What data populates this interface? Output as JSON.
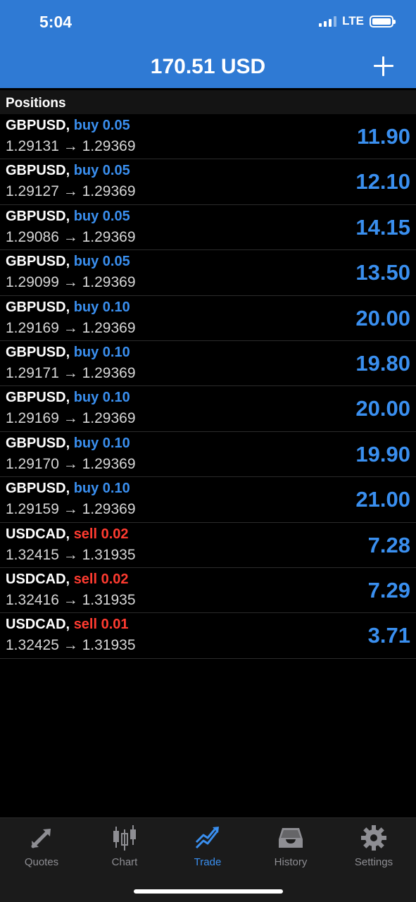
{
  "status": {
    "time": "5:04",
    "network": "LTE"
  },
  "header": {
    "balance": "170.51 USD"
  },
  "section": {
    "title": "Positions"
  },
  "positions": [
    {
      "symbol": "GBPUSD,",
      "side": "buy",
      "side_text": "buy 0.05",
      "open": "1.29131",
      "arrow": "→",
      "current": "1.29369",
      "profit": "11.90"
    },
    {
      "symbol": "GBPUSD,",
      "side": "buy",
      "side_text": "buy 0.05",
      "open": "1.29127",
      "arrow": "→",
      "current": "1.29369",
      "profit": "12.10"
    },
    {
      "symbol": "GBPUSD,",
      "side": "buy",
      "side_text": "buy 0.05",
      "open": "1.29086",
      "arrow": "→",
      "current": "1.29369",
      "profit": "14.15"
    },
    {
      "symbol": "GBPUSD,",
      "side": "buy",
      "side_text": "buy 0.05",
      "open": "1.29099",
      "arrow": "→",
      "current": "1.29369",
      "profit": "13.50"
    },
    {
      "symbol": "GBPUSD,",
      "side": "buy",
      "side_text": "buy 0.10",
      "open": "1.29169",
      "arrow": "→",
      "current": "1.29369",
      "profit": "20.00"
    },
    {
      "symbol": "GBPUSD,",
      "side": "buy",
      "side_text": "buy 0.10",
      "open": "1.29171",
      "arrow": "→",
      "current": "1.29369",
      "profit": "19.80"
    },
    {
      "symbol": "GBPUSD,",
      "side": "buy",
      "side_text": "buy 0.10",
      "open": "1.29169",
      "arrow": "→",
      "current": "1.29369",
      "profit": "20.00"
    },
    {
      "symbol": "GBPUSD,",
      "side": "buy",
      "side_text": "buy 0.10",
      "open": "1.29170",
      "arrow": "→",
      "current": "1.29369",
      "profit": "19.90"
    },
    {
      "symbol": "GBPUSD,",
      "side": "buy",
      "side_text": "buy 0.10",
      "open": "1.29159",
      "arrow": "→",
      "current": "1.29369",
      "profit": "21.00"
    },
    {
      "symbol": "USDCAD,",
      "side": "sell",
      "side_text": "sell 0.02",
      "open": "1.32415",
      "arrow": "→",
      "current": "1.31935",
      "profit": "7.28"
    },
    {
      "symbol": "USDCAD,",
      "side": "sell",
      "side_text": "sell 0.02",
      "open": "1.32416",
      "arrow": "→",
      "current": "1.31935",
      "profit": "7.29"
    },
    {
      "symbol": "USDCAD,",
      "side": "sell",
      "side_text": "sell 0.01",
      "open": "1.32425",
      "arrow": "→",
      "current": "1.31935",
      "profit": "3.71"
    }
  ],
  "tabs": [
    {
      "label": "Quotes",
      "icon": "quotes-arrows-icon",
      "active": false
    },
    {
      "label": "Chart",
      "icon": "candlestick-icon",
      "active": false
    },
    {
      "label": "Trade",
      "icon": "trend-up-icon",
      "active": true
    },
    {
      "label": "History",
      "icon": "inbox-tray-icon",
      "active": false
    },
    {
      "label": "Settings",
      "icon": "gear-icon",
      "active": false
    }
  ],
  "colors": {
    "header_bg": "#2f7ad4",
    "buy": "#3a8fef",
    "sell": "#ff3b30",
    "profit": "#3a8fef",
    "tab_inactive": "#8e8e93",
    "tab_active": "#3a8fef"
  }
}
